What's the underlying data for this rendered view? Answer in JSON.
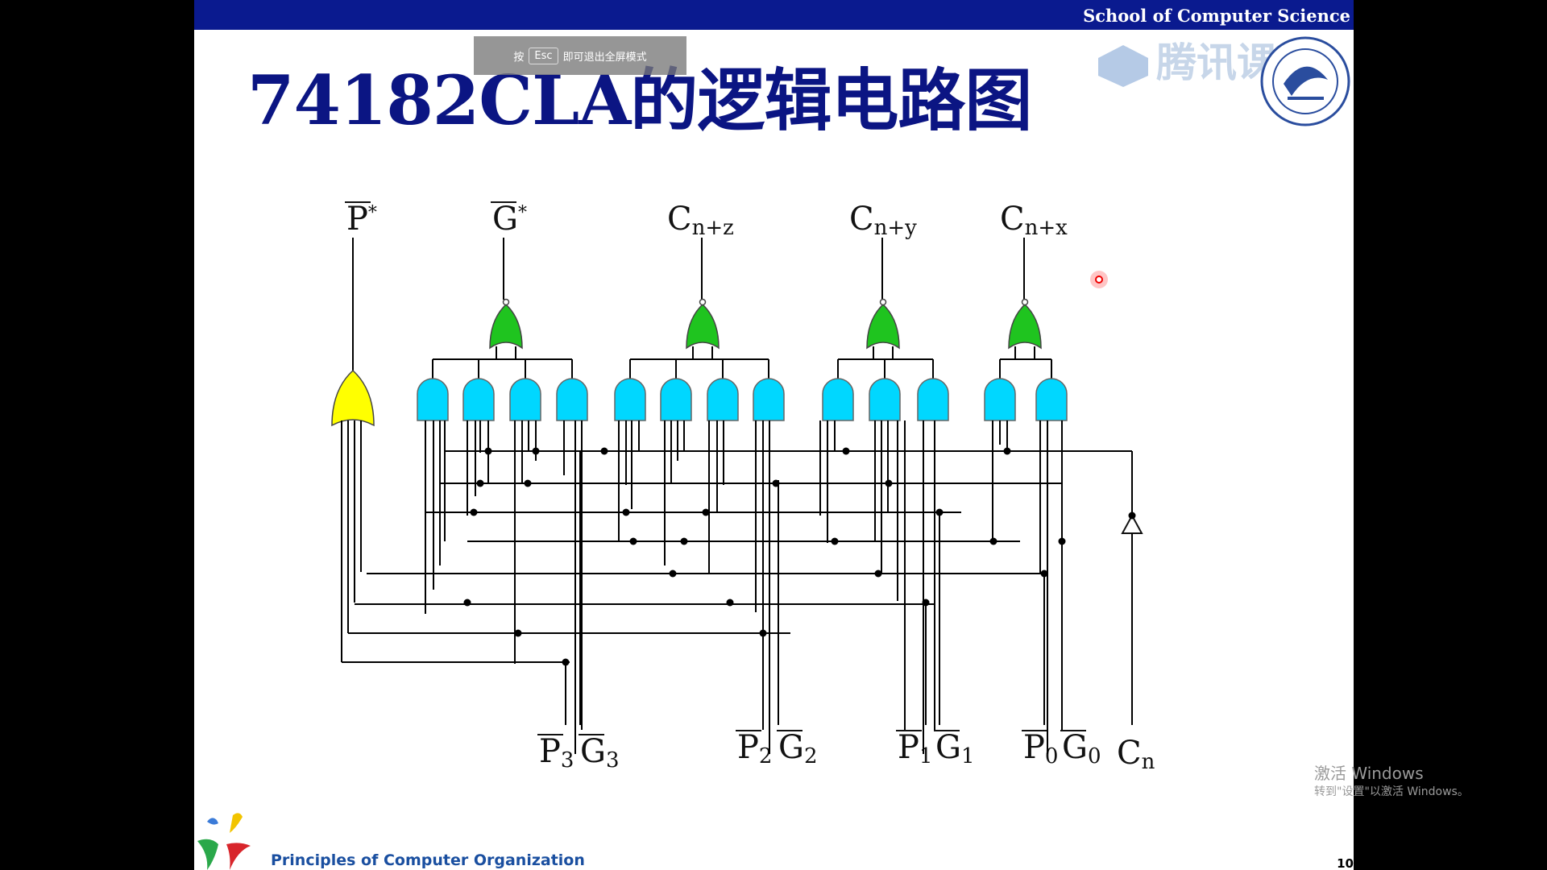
{
  "header": {
    "school": "School of Computer Science"
  },
  "overlay": {
    "esc_prefix": "按",
    "esc_key": "Esc",
    "esc_suffix": "即可退出全屏模式",
    "watermark": "腾讯课堂"
  },
  "slide": {
    "title": "74182CLA的逻辑电路图"
  },
  "circuit": {
    "outputs": [
      {
        "name": "P",
        "sup": "*",
        "overbar": true
      },
      {
        "name": "G",
        "sup": "*",
        "overbar": true
      },
      {
        "name": "C",
        "sub": "n+z",
        "overbar": false
      },
      {
        "name": "C",
        "sub": "n+y",
        "overbar": false
      },
      {
        "name": "C",
        "sub": "n+x",
        "overbar": false
      }
    ],
    "inputs": [
      {
        "name": "P",
        "sub": "3",
        "overbar": true
      },
      {
        "name": "G",
        "sub": "3",
        "overbar": true
      },
      {
        "name": "P",
        "sub": "2",
        "overbar": true
      },
      {
        "name": "G",
        "sub": "2",
        "overbar": true
      },
      {
        "name": "P",
        "sub": "1",
        "overbar": true
      },
      {
        "name": "G",
        "sub": "1",
        "overbar": true
      },
      {
        "name": "P",
        "sub": "0",
        "overbar": true
      },
      {
        "name": "G",
        "sub": "0",
        "overbar": true
      },
      {
        "name": "C",
        "sub": "n",
        "overbar": false
      }
    ],
    "colors": {
      "or_output_gate": "#ffff00",
      "nor_gate": "#1fc41f",
      "and_gate": "#00d7ff",
      "wire": "#000000"
    }
  },
  "footer": {
    "course": "Principles of Computer Organization",
    "page": "10"
  },
  "system": {
    "activate_title": "激活 Windows",
    "activate_sub": "转到\"设置\"以激活 Windows。"
  }
}
